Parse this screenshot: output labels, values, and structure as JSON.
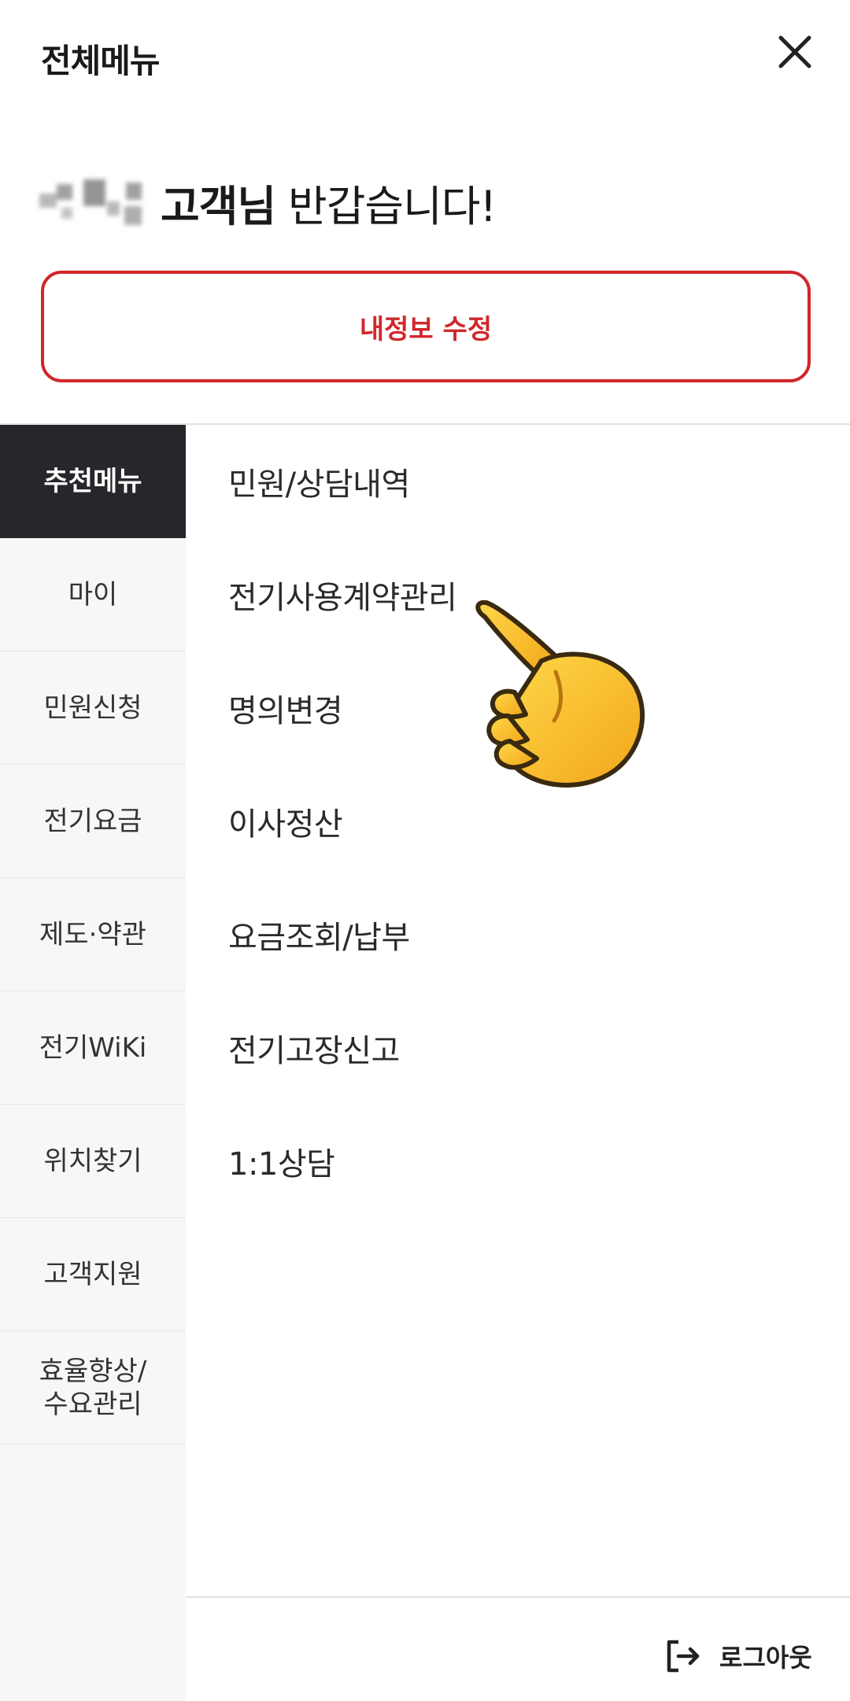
{
  "header": {
    "title": "전체메뉴",
    "close_icon": "close-icon"
  },
  "greeting": {
    "honorific": "고객님",
    "message": "반갑습니다!"
  },
  "profile_edit_button": {
    "label": "내정보 수정",
    "color": "#d0272c"
  },
  "sidebar": {
    "items": [
      {
        "label": "추천메뉴",
        "active": true
      },
      {
        "label": "마이"
      },
      {
        "label": "민원신청"
      },
      {
        "label": "전기요금"
      },
      {
        "label": "제도·약관"
      },
      {
        "label": "전기WiKi"
      },
      {
        "label": "위치찾기"
      },
      {
        "label": "고객지원"
      },
      {
        "label": "효율향상/\n수요관리"
      }
    ]
  },
  "main_menu": {
    "items": [
      {
        "label": "민원/상담내역"
      },
      {
        "label": "전기사용계약관리"
      },
      {
        "label": "명의변경"
      },
      {
        "label": "이사정산"
      },
      {
        "label": "요금조회/납부"
      },
      {
        "label": "전기고장신고"
      },
      {
        "label": "1:1상담"
      }
    ]
  },
  "footer": {
    "logout_label": "로그아웃",
    "logout_icon": "logout-icon"
  },
  "overlay": {
    "icon": "pointing-hand-icon"
  },
  "colors": {
    "accent": "#d0272c",
    "active_sidebar_bg": "#26272b",
    "sidebar_bg": "#f7f7f7"
  }
}
